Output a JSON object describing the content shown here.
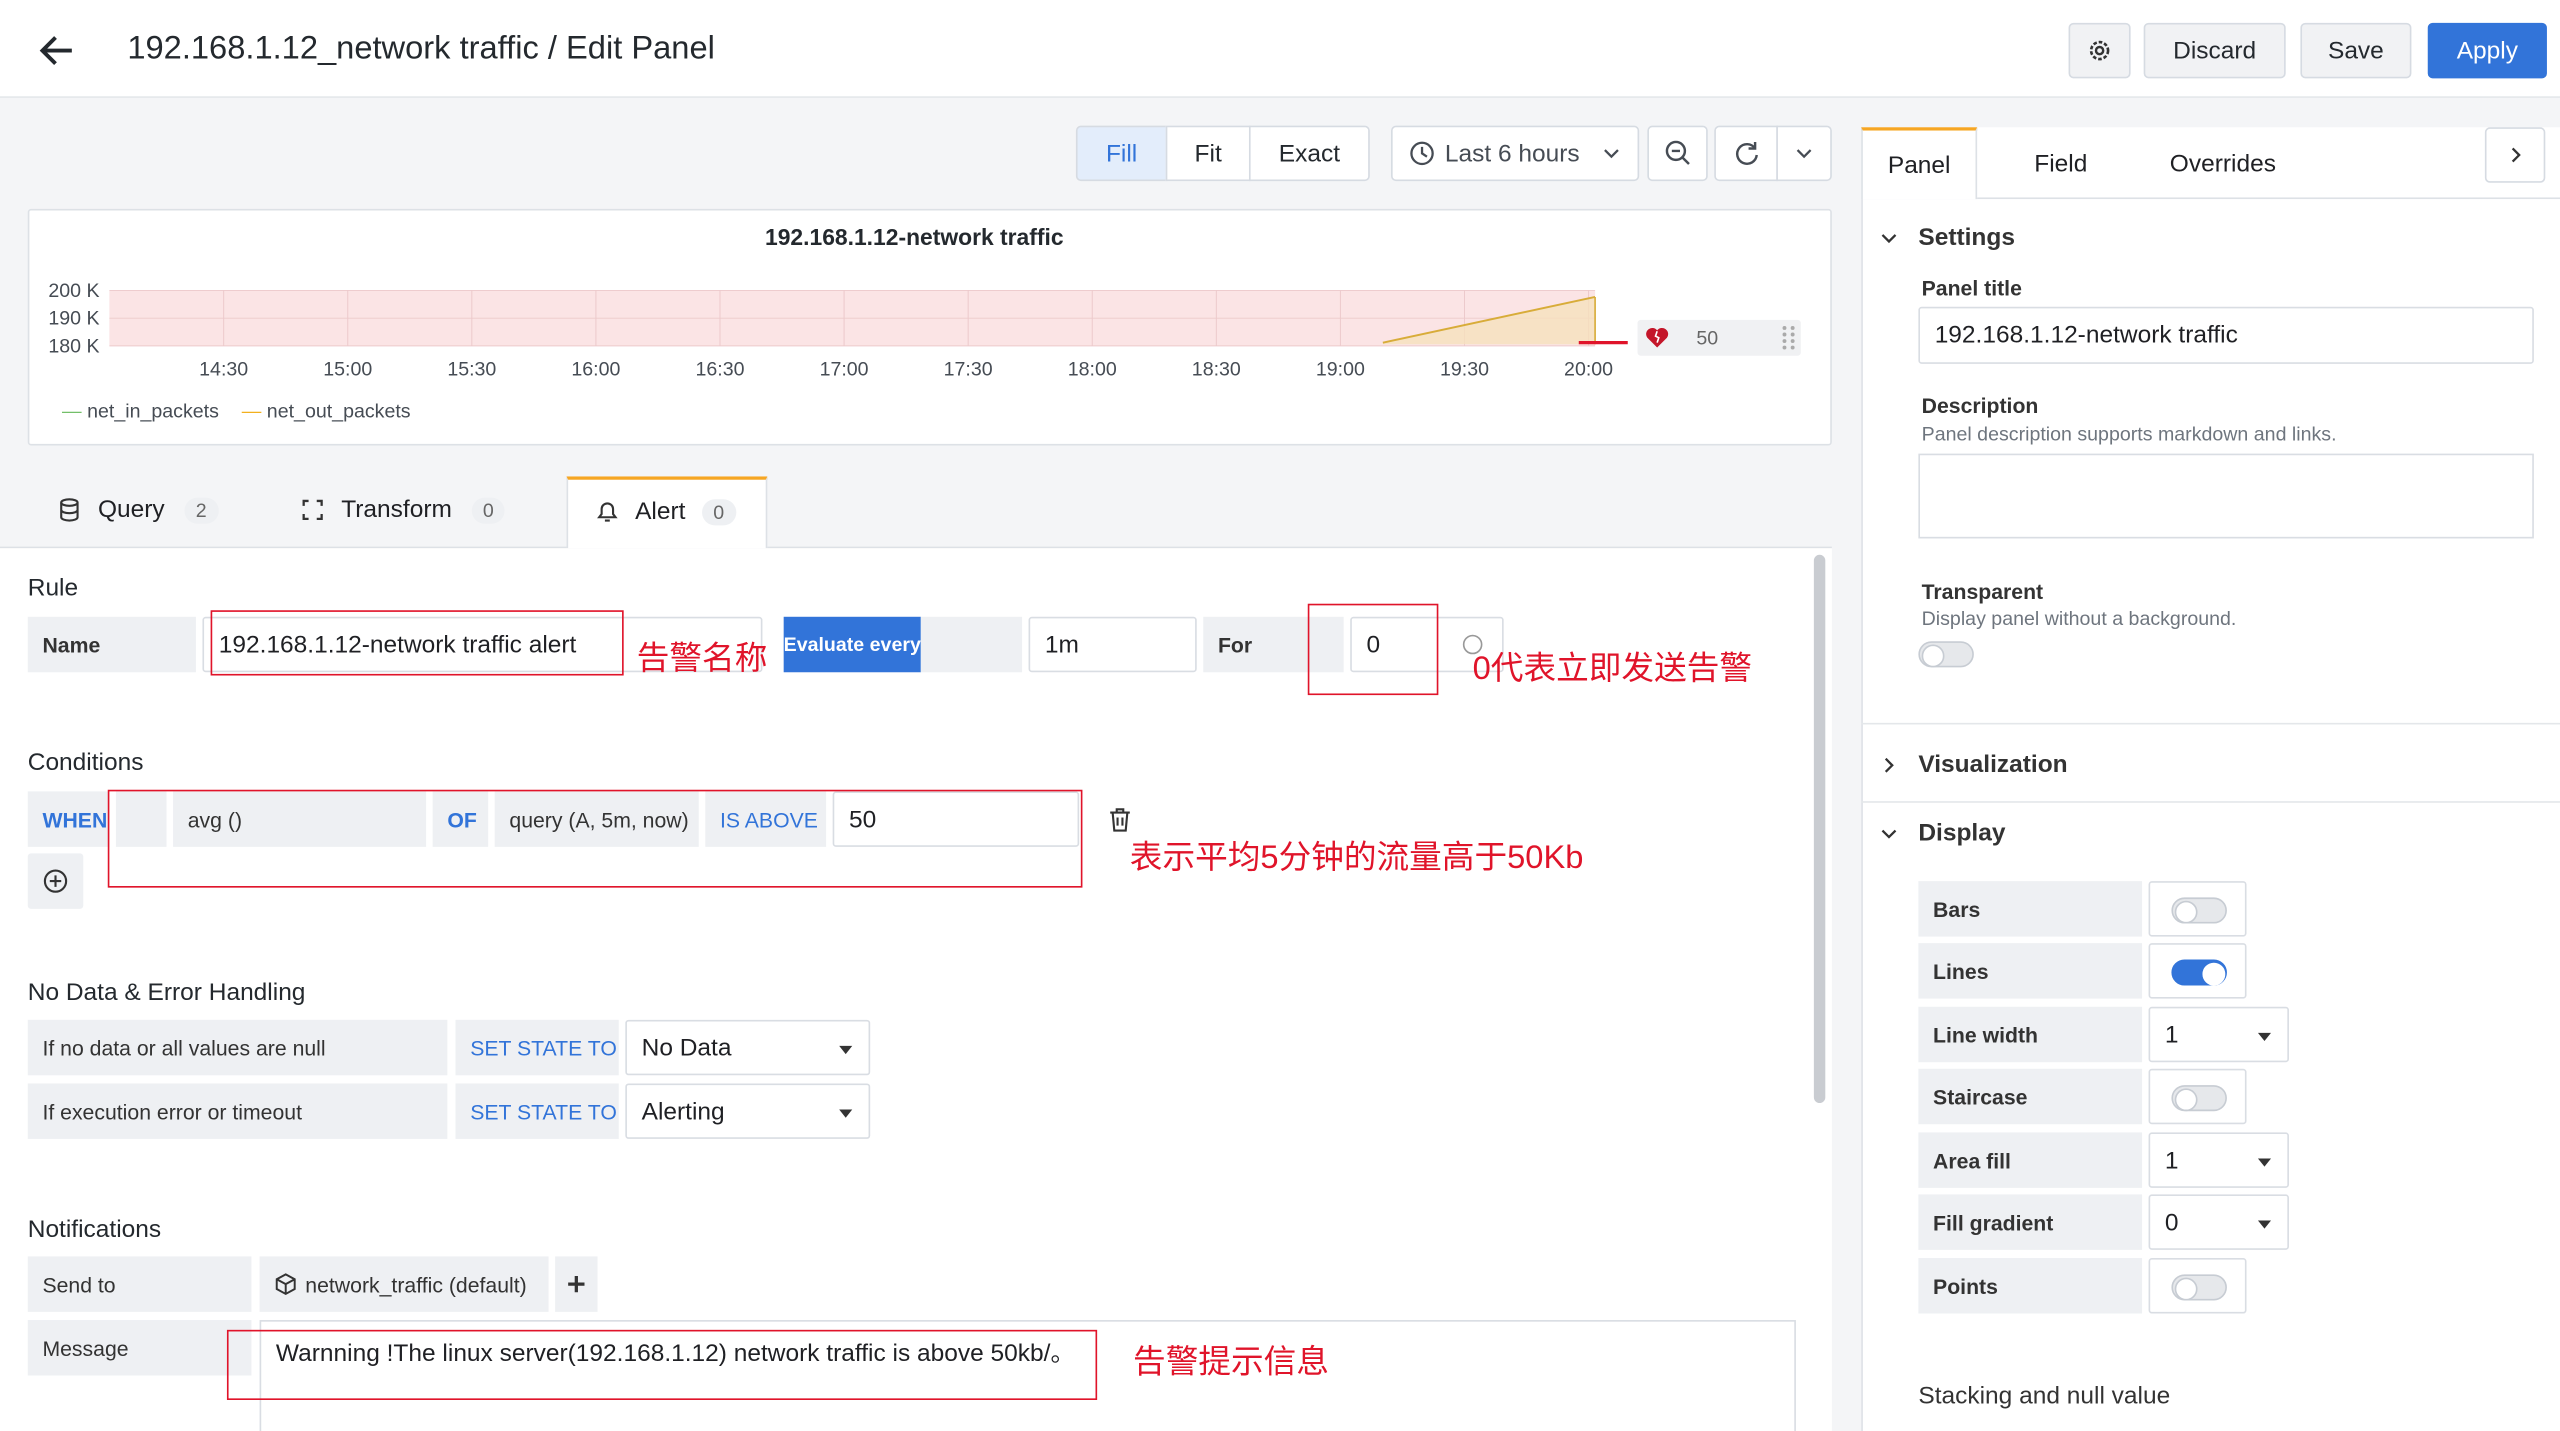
{
  "header": {
    "title": "192.168.1.12_network traffic / Edit Panel",
    "discard": "Discard",
    "save": "Save",
    "apply": "Apply"
  },
  "toolbar": {
    "fill": "Fill",
    "fit": "Fit",
    "exact": "Exact",
    "time_range": "Last 6 hours"
  },
  "chart_data": {
    "type": "line",
    "title": "192.168.1.12-network traffic",
    "y_ticks": [
      "200 K",
      "190 K",
      "180 K"
    ],
    "x_ticks": [
      "14:30",
      "15:00",
      "15:30",
      "16:00",
      "16:30",
      "17:00",
      "17:30",
      "18:00",
      "18:30",
      "19:00",
      "19:30",
      "20:00"
    ],
    "series": [
      {
        "name": "net_in_packets",
        "color": "#73bf69"
      },
      {
        "name": "net_out_packets",
        "color": "#f2b01e"
      }
    ],
    "threshold": 50,
    "threshold_label": "50"
  },
  "tabs": {
    "query": "Query",
    "query_count": "2",
    "transform": "Transform",
    "transform_count": "0",
    "alert": "Alert",
    "alert_count": "0"
  },
  "rule": {
    "heading": "Rule",
    "name_label": "Name",
    "name_value": "192.168.1.12-network traffic alert",
    "evaluate_label": "Evaluate every",
    "evaluate_value": "1m",
    "for_label": "For",
    "for_value": "0"
  },
  "conditions": {
    "heading": "Conditions",
    "when": "WHEN",
    "func": "avg ()",
    "of": "OF",
    "query": "query (A, 5m, now)",
    "is_above": "IS ABOVE",
    "threshold": "50"
  },
  "nodata": {
    "heading": "No Data & Error Handling",
    "row1_label": "If no data or all values are null",
    "set_state": "SET STATE TO",
    "row1_value": "No Data",
    "row2_label": "If execution error or timeout",
    "row2_value": "Alerting"
  },
  "notifications": {
    "heading": "Notifications",
    "send_to_label": "Send to",
    "channel": "network_traffic (default)",
    "message_label": "Message",
    "message_value": "Warnning !The linux server(192.168.1.12) network traffic is above 50kb/。"
  },
  "annotations": {
    "a1": "告警名称",
    "a2": "0代表立即发送告警",
    "a3": "表示平均5分钟的流量高于50Kb",
    "a4": "告警提示信息"
  },
  "side": {
    "tab_panel": "Panel",
    "tab_field": "Field",
    "tab_overrides": "Overrides",
    "settings": "Settings",
    "panel_title_label": "Panel title",
    "panel_title_value": "192.168.1.12-network traffic",
    "description_label": "Description",
    "description_hint": "Panel description supports markdown and links.",
    "transparent_label": "Transparent",
    "transparent_hint": "Display panel without a background.",
    "visualization": "Visualization",
    "display": "Display",
    "bars": "Bars",
    "lines": "Lines",
    "line_width": "Line width",
    "line_width_value": "1",
    "staircase": "Staircase",
    "area_fill": "Area fill",
    "area_fill_value": "1",
    "fill_gradient": "Fill gradient",
    "fill_gradient_value": "0",
    "points": "Points",
    "stacking": "Stacking and null value"
  }
}
